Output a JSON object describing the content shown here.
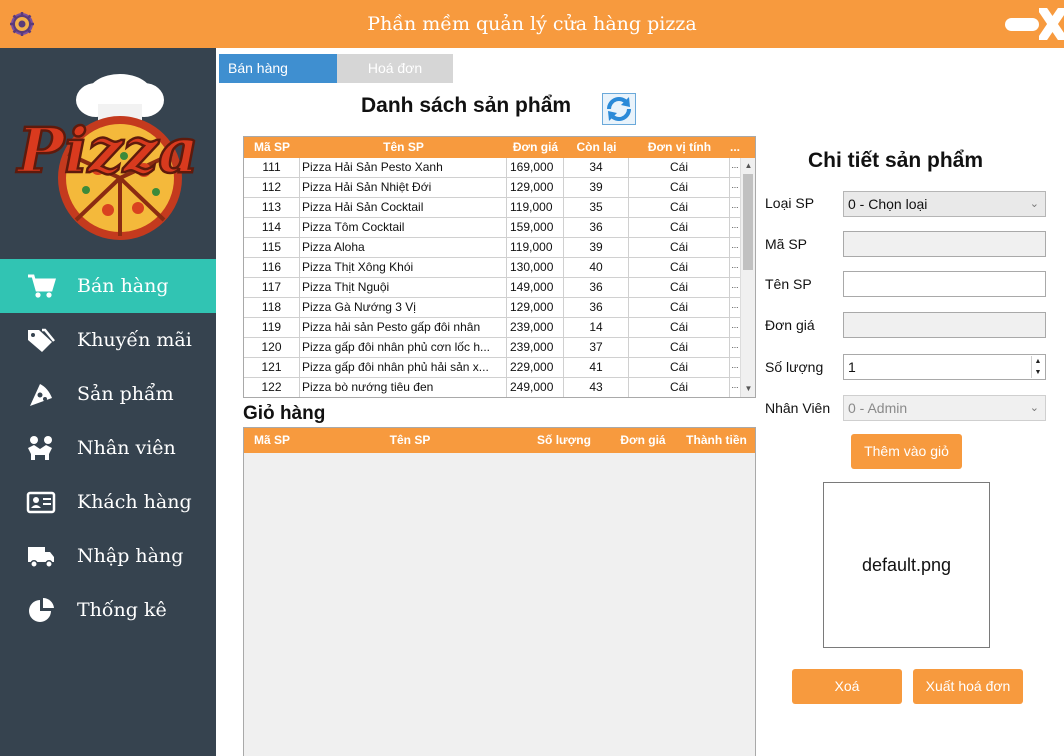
{
  "window": {
    "title": "Phần mềm quản lý cửa hàng pizza"
  },
  "colors": {
    "accent": "#f79a3e",
    "sidebar": "#36434f",
    "active_nav": "#31c4b3",
    "tab_active": "#3f8fd0",
    "tab_inactive": "#d6d6d6"
  },
  "logo": {
    "text": "Pizza"
  },
  "nav": [
    {
      "label": "Bán hàng",
      "icon": "cart-icon",
      "active": true
    },
    {
      "label": "Khuyến mãi",
      "icon": "tags-icon",
      "active": false
    },
    {
      "label": "Sản phẩm",
      "icon": "pizza-slice-icon",
      "active": false
    },
    {
      "label": "Nhân viên",
      "icon": "staff-icon",
      "active": false
    },
    {
      "label": "Khách hàng",
      "icon": "id-card-icon",
      "active": false
    },
    {
      "label": "Nhập hàng",
      "icon": "truck-icon",
      "active": false
    },
    {
      "label": "Thống kê",
      "icon": "pie-chart-icon",
      "active": false
    }
  ],
  "tabs": [
    {
      "label": "Bán hàng",
      "active": true
    },
    {
      "label": "Hoá đơn",
      "active": false
    }
  ],
  "products": {
    "title": "Danh sách sản phẩm",
    "refresh_icon": "refresh-icon",
    "columns": [
      "Mã SP",
      "Tên SP",
      "Đơn giá",
      "Còn lại",
      "Đơn vị tính",
      "..."
    ],
    "rows": [
      [
        "111",
        "Pizza Hải Sản Pesto Xanh",
        "169,000",
        "34",
        "Cái"
      ],
      [
        "112",
        "Pizza Hải Sản Nhiệt Đới",
        "129,000",
        "39",
        "Cái"
      ],
      [
        "113",
        "Pizza Hải Sản Cocktail",
        "119,000",
        "35",
        "Cái"
      ],
      [
        "114",
        "Pizza Tôm Cocktail",
        "159,000",
        "36",
        "Cái"
      ],
      [
        "115",
        "Pizza Aloha",
        "119,000",
        "39",
        "Cái"
      ],
      [
        "116",
        "Pizza Thịt Xông Khói",
        "130,000",
        "40",
        "Cái"
      ],
      [
        "117",
        "Pizza Thịt Nguội",
        "149,000",
        "36",
        "Cái"
      ],
      [
        "118",
        "Pizza Gà Nướng 3 Vị",
        "129,000",
        "36",
        "Cái"
      ],
      [
        "119",
        "Pizza hải sản Pesto gấp đôi nhân",
        "239,000",
        "14",
        "Cái"
      ],
      [
        "120",
        "Pizza gấp đôi nhân phủ cơn lốc h...",
        "239,000",
        "37",
        "Cái"
      ],
      [
        "121",
        "Pizza gấp đôi nhân phủ hải sản x...",
        "229,000",
        "41",
        "Cái"
      ],
      [
        "122",
        "Pizza bò nướng tiêu đen",
        "249,000",
        "43",
        "Cái"
      ]
    ],
    "more_cell": "..."
  },
  "cart": {
    "title": "Giỏ hàng",
    "columns": [
      "Mã SP",
      "Tên SP",
      "Số lượng",
      "Đơn giá",
      "Thành tiền"
    ]
  },
  "detail": {
    "title": "Chi tiết sản phẩm",
    "loai_label": "Loại SP",
    "loai_value": "0 - Chọn loại",
    "ma_label": "Mã SP",
    "ma_value": "",
    "ten_label": "Tên SP",
    "ten_value": "",
    "gia_label": "Đơn giá",
    "gia_value": "",
    "sl_label": "Số lượng",
    "sl_value": "1",
    "nv_label": "Nhân Viên",
    "nv_value": "0 - Admin",
    "add_button": "Thêm vào giỏ",
    "image_name": "default.png",
    "delete_button": "Xoá",
    "invoice_button": "Xuất hoá đơn"
  }
}
